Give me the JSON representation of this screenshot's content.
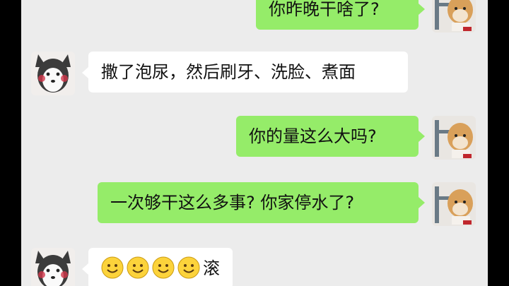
{
  "messages": [
    {
      "side": "right",
      "text": "你昨晚干啥了?"
    },
    {
      "side": "left",
      "text": "撒了泡尿，然后刷牙、洗脸、煮面"
    },
    {
      "side": "right",
      "text": "你的量这么大吗?"
    },
    {
      "side": "right",
      "text": "一次够干这么多事? 你家停水了?"
    },
    {
      "side": "left",
      "emoji": [
        "smile-emoji",
        "smile-emoji",
        "smile-emoji",
        "smile-emoji"
      ],
      "text": "滚"
    }
  ],
  "colors": {
    "outgoing_bubble": "#95ec69",
    "incoming_bubble": "#ffffff",
    "chat_background": "#ececec"
  },
  "avatars": {
    "self": "shiba-dog-avatar",
    "contact": "husky-dog-avatar"
  }
}
